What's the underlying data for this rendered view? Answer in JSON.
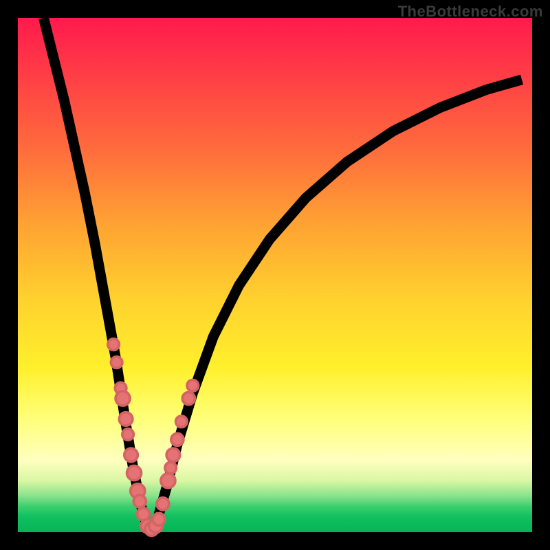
{
  "watermark": "TheBottleneck.com",
  "colors": {
    "frame": "#000000",
    "curve": "#000000",
    "dot": "#e57373",
    "gradient_top": "#ff1a4d",
    "gradient_bottom": "#06b456"
  },
  "chart_data": {
    "type": "line",
    "title": "",
    "xlabel": "",
    "ylabel": "",
    "xlim": [
      0,
      100
    ],
    "ylim": [
      0,
      100
    ],
    "left_branch": {
      "x": [
        5,
        7,
        9,
        11,
        13,
        15,
        17,
        19,
        21,
        22.5,
        24,
        25,
        25.8
      ],
      "y": [
        100,
        92,
        84,
        75,
        66,
        56,
        45,
        34,
        21,
        12,
        5,
        1.5,
        0.5
      ]
    },
    "right_branch": {
      "x": [
        25.8,
        27,
        29,
        31,
        34,
        38,
        43,
        49,
        56,
        64,
        73,
        82,
        91,
        98
      ],
      "y": [
        0.5,
        2,
        9,
        17,
        27,
        38,
        48,
        57,
        65,
        72,
        78,
        82.5,
        86,
        88
      ]
    },
    "dots": [
      {
        "x": 18.6,
        "y": 36.5,
        "r": 1.1
      },
      {
        "x": 19.2,
        "y": 33.0,
        "r": 1.1
      },
      {
        "x": 20.0,
        "y": 28.0,
        "r": 1.1
      },
      {
        "x": 20.4,
        "y": 26.0,
        "r": 1.4
      },
      {
        "x": 21.0,
        "y": 22.0,
        "r": 1.3
      },
      {
        "x": 21.4,
        "y": 19.0,
        "r": 1.1
      },
      {
        "x": 22.0,
        "y": 15.0,
        "r": 1.3
      },
      {
        "x": 22.6,
        "y": 11.5,
        "r": 1.4
      },
      {
        "x": 23.3,
        "y": 8.0,
        "r": 1.4
      },
      {
        "x": 23.7,
        "y": 6.0,
        "r": 1.2
      },
      {
        "x": 24.4,
        "y": 3.5,
        "r": 1.2
      },
      {
        "x": 25.2,
        "y": 1.2,
        "r": 1.3
      },
      {
        "x": 26.0,
        "y": 0.6,
        "r": 1.3
      },
      {
        "x": 26.8,
        "y": 1.2,
        "r": 1.3
      },
      {
        "x": 27.4,
        "y": 2.5,
        "r": 1.2
      },
      {
        "x": 28.2,
        "y": 5.5,
        "r": 1.2
      },
      {
        "x": 29.2,
        "y": 10.0,
        "r": 1.4
      },
      {
        "x": 29.7,
        "y": 12.5,
        "r": 1.1
      },
      {
        "x": 30.2,
        "y": 15.0,
        "r": 1.3
      },
      {
        "x": 31.0,
        "y": 18.0,
        "r": 1.2
      },
      {
        "x": 31.8,
        "y": 21.5,
        "r": 1.1
      },
      {
        "x": 33.2,
        "y": 26.0,
        "r": 1.2
      },
      {
        "x": 34.0,
        "y": 28.5,
        "r": 1.1
      }
    ]
  }
}
